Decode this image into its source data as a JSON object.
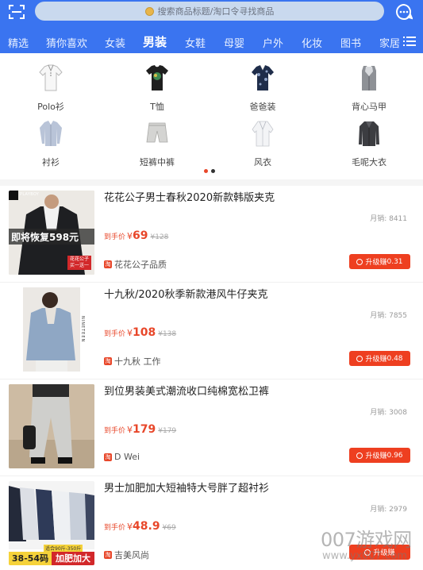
{
  "header": {
    "search_placeholder": "搜索商品标题/淘口令寻找商品",
    "colors": {
      "brand": "#3a74f0",
      "accent": "#ee3f20"
    }
  },
  "tabs": [
    "精选",
    "猜你喜欢",
    "女装",
    "男装",
    "女鞋",
    "母婴",
    "户外",
    "化妆",
    "图书",
    "家居"
  ],
  "active_tab": "男装",
  "categories": [
    {
      "label": "Polo衫",
      "icon": "polo-shirt-icon"
    },
    {
      "label": "T恤",
      "icon": "t-shirt-icon"
    },
    {
      "label": "爸爸装",
      "icon": "dad-shirt-icon"
    },
    {
      "label": "背心马甲",
      "icon": "vest-icon"
    },
    {
      "label": "衬衫",
      "icon": "dress-shirt-icon"
    },
    {
      "label": "短裤中裤",
      "icon": "shorts-icon"
    },
    {
      "label": "风衣",
      "icon": "trench-coat-icon"
    },
    {
      "label": "毛呢大衣",
      "icon": "wool-coat-icon"
    }
  ],
  "carousel": {
    "page": 1,
    "total": 2
  },
  "product_labels": {
    "price_label": "到手价",
    "currency": "¥",
    "sales_prefix": "月销: ",
    "shop_badge": "淘",
    "upgrade_prefix": "升级赚"
  },
  "products": [
    {
      "title": "花花公子男士春秋2020新款韩版夹克",
      "price": "69",
      "original_price": "¥128",
      "sales": "8411",
      "shop": "花花公子品质",
      "earn": "0.31",
      "image_text": {
        "banner": "即将恢复598元",
        "brand": "PLAYBOY",
        "tag": "花花公子 买一送一"
      }
    },
    {
      "title": "十九秋/2020秋季新款港风牛仔夹克",
      "price": "108",
      "original_price": "¥138",
      "sales": "7855",
      "shop": "十九秋 工作",
      "earn": "0.48",
      "image_text": {
        "brand": "NINETEEN"
      }
    },
    {
      "title": "到位男装美式潮流收口纯棉宽松卫裤",
      "price": "179",
      "original_price": "¥179",
      "sales": "3008",
      "shop": "D Wei",
      "earn": "0.96",
      "image_text": {}
    },
    {
      "title": "男士加肥加大短袖特大号胖了超衬衫",
      "price": "48.9",
      "original_price": "¥69",
      "sales": "2979",
      "shop": "吉美风尚",
      "earn": "",
      "image_text": {
        "range": "适合90斤-350斤",
        "size": "38-54码",
        "tag": "加肥加大"
      }
    }
  ],
  "watermark": {
    "title": "007游戏网",
    "url": "www.yx007.com"
  }
}
